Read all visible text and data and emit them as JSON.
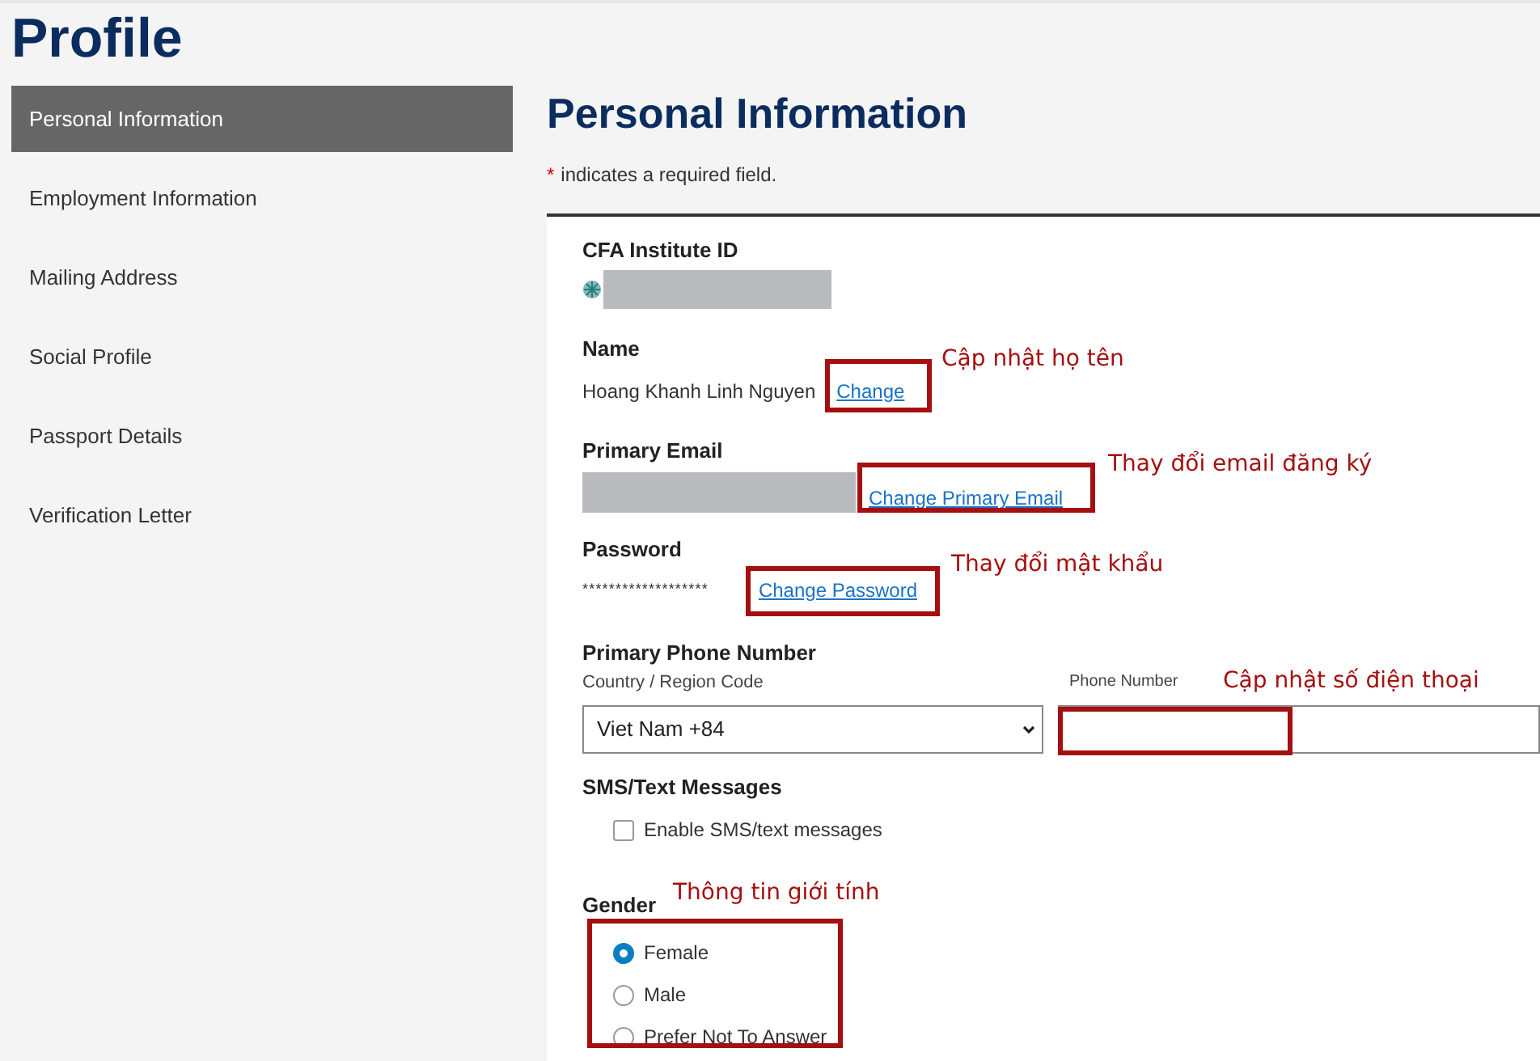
{
  "page_title": "Profile",
  "sidebar": {
    "items": [
      {
        "label": "Personal Information",
        "selected": true
      },
      {
        "label": "Employment Information",
        "selected": false
      },
      {
        "label": "Mailing Address",
        "selected": false
      },
      {
        "label": "Social Profile",
        "selected": false
      },
      {
        "label": "Passport Details",
        "selected": false
      },
      {
        "label": "Verification Letter",
        "selected": false
      }
    ]
  },
  "section": {
    "title": "Personal Information",
    "required_mark": "*",
    "required_note": "indicates a required field."
  },
  "id_field": {
    "label": "CFA Institute ID"
  },
  "name_field": {
    "label": "Name",
    "value": "Hoang Khanh Linh Nguyen",
    "link": "Change"
  },
  "email_field": {
    "label": "Primary Email",
    "link": "Change Primary Email"
  },
  "password_field": {
    "label": "Password",
    "value": "*******************",
    "link": "Change Password"
  },
  "phone": {
    "label": "Primary Phone Number",
    "country_label": "Country / Region Code",
    "country_value": "Viet Nam +84",
    "number_label": "Phone Number"
  },
  "sms": {
    "label": "SMS/Text Messages",
    "option": "Enable SMS/text messages",
    "checked": false
  },
  "gender": {
    "label": "Gender",
    "options": [
      {
        "label": "Female",
        "selected": true
      },
      {
        "label": "Male",
        "selected": false
      },
      {
        "label": "Prefer Not To Answer",
        "selected": false
      }
    ]
  },
  "annotations": [
    {
      "text": "Cập nhật họ tên"
    },
    {
      "text": "Thay đổi email đăng ký"
    },
    {
      "text": "Thay đổi mật khẩu"
    },
    {
      "text": "Cập nhật số điện thoại"
    },
    {
      "text": "Thông tin giới tính"
    }
  ]
}
